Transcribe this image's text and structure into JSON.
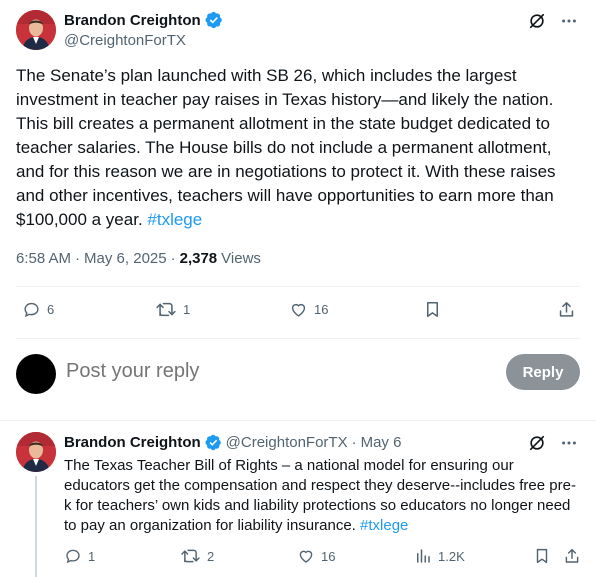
{
  "post": {
    "author_name": "Brandon Creighton",
    "author_handle": "@CreightonForTX",
    "text": "The Senate’s plan launched with SB 26, which includes the largest investment in teacher pay raises in Texas history—and likely the nation. This bill creates a permanent allotment in the state budget dedicated to teacher salaries. The House bills do not include a permanent allotment, and for this reason we are in negotiations to protect it. With these raises and other incentives, teachers will have opportunities to earn more than $100,000 a year. ",
    "hashtag": "#txlege",
    "time": "6:58 AM",
    "date": "May 6, 2025",
    "views_count": "2,378",
    "views_label": "Views",
    "replies": "6",
    "reposts": "1",
    "likes": "16",
    "icons": [
      "grok-icon",
      "more-icon",
      "verified-badge-icon",
      "reply-icon",
      "repost-icon",
      "like-icon",
      "bookmark-icon",
      "share-icon"
    ]
  },
  "composer": {
    "placeholder": "Post your reply",
    "button_label": "Reply"
  },
  "reply": {
    "author_name": "Brandon Creighton",
    "author_handle": "@CreightonForTX",
    "date": "May 6",
    "text": "The Texas Teacher Bill of Rights – a national model for ensuring our educators get the compensation and respect they deserve--includes free pre-k for teachers’ own kids and liability protections so educators no longer need to pay an organization for liability insurance. ",
    "hashtag": "#txlege",
    "replies": "1",
    "reposts": "2",
    "likes": "16",
    "views": "1.2K",
    "icons": [
      "grok-icon",
      "more-icon",
      "verified-badge-icon",
      "reply-icon",
      "repost-icon",
      "like-icon",
      "views-icon",
      "bookmark-icon",
      "share-icon"
    ]
  },
  "colors": {
    "accent": "#1d9bf0",
    "text": "#0f1419",
    "secondary": "#536471",
    "reply_button": "#8b9298"
  }
}
